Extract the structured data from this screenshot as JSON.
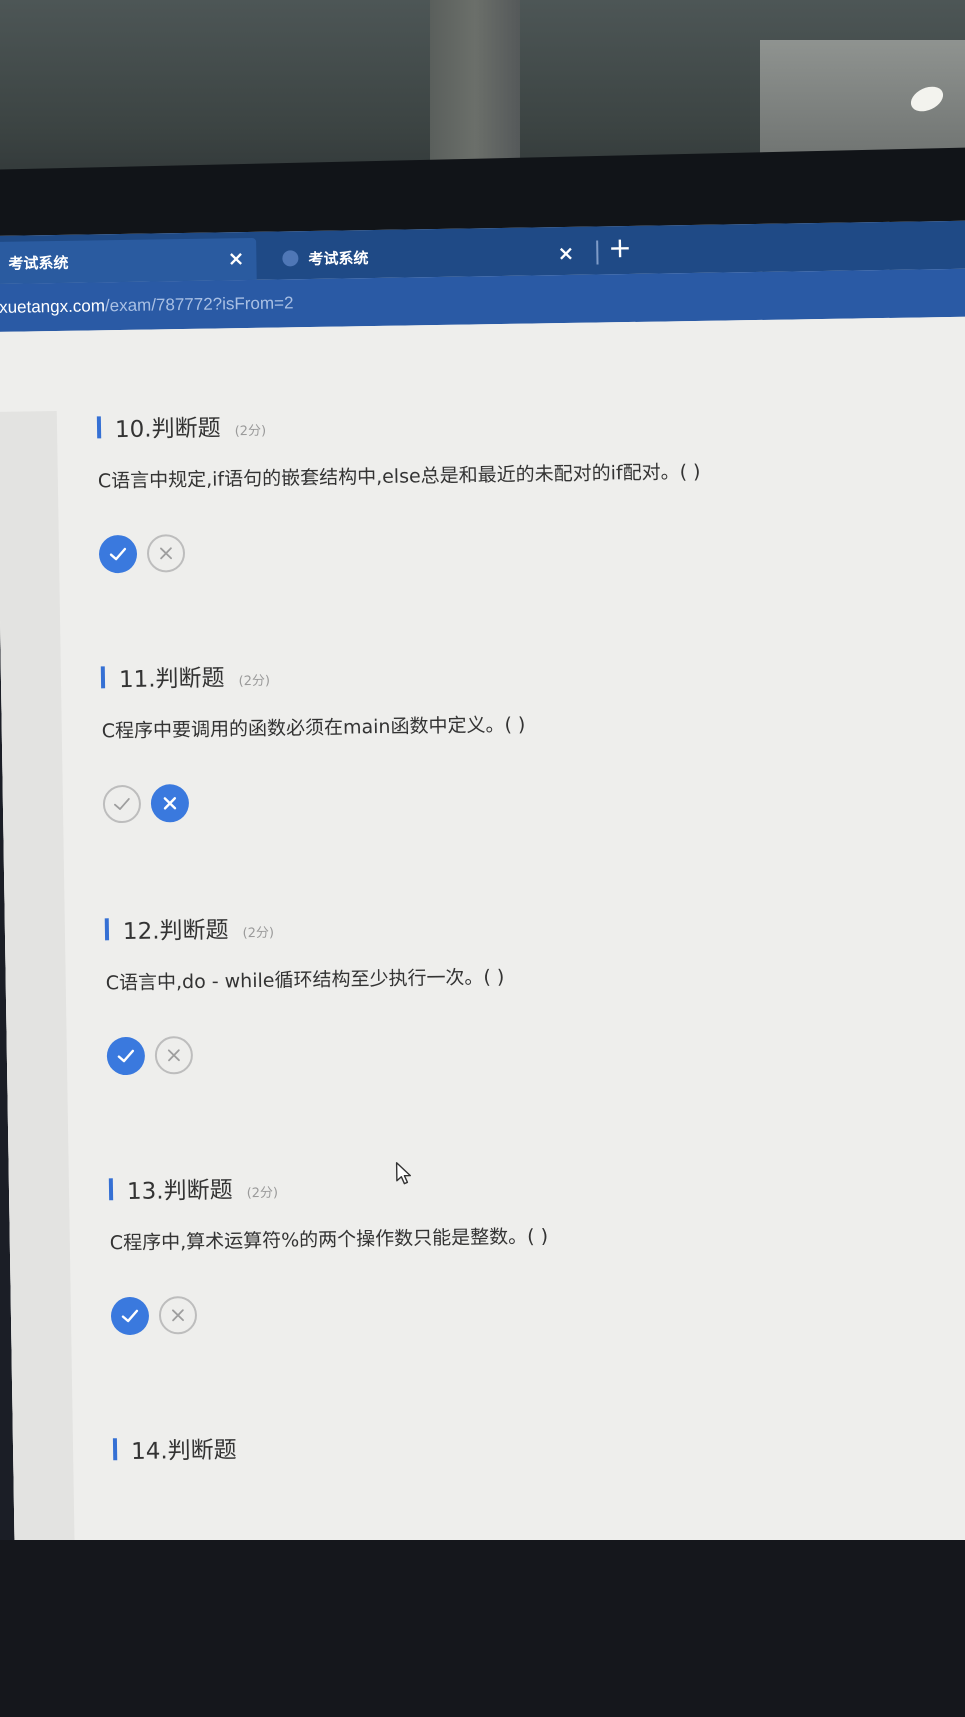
{
  "browser": {
    "tabs": [
      {
        "label": "考试系统",
        "active": true
      },
      {
        "label": "考试系统",
        "active": false
      }
    ],
    "new_tab_symbol": "+",
    "close_symbol": "×",
    "url_domain": "xuetangx.com",
    "url_path": "/exam/787772?isFrom=2"
  },
  "questions": [
    {
      "title": "10.判断题",
      "points": "(2分)",
      "text": "C语言中规定,if语句的嵌套结构中,else总是和最近的未配对的if配对。( )",
      "selected": "true"
    },
    {
      "title": "11.判断题",
      "points": "(2分)",
      "text": "C程序中要调用的函数必须在main函数中定义。( )",
      "selected": "false"
    },
    {
      "title": "12.判断题",
      "points": "(2分)",
      "text": "C语言中,do - while循环结构至少执行一次。( )",
      "selected": "true"
    },
    {
      "title": "13.判断题",
      "points": "(2分)",
      "text": "C程序中,算术运算符%的两个操作数只能是整数。( )",
      "selected": "true"
    },
    {
      "title": "14.判断题",
      "points": "",
      "text": "",
      "selected": ""
    }
  ],
  "colors": {
    "accent": "#3a79de",
    "tabbar": "#1f4a86",
    "addressbar": "#2a5aa5"
  },
  "icons": {
    "true_option": "check-icon",
    "false_option": "cross-icon",
    "tab": "favicon-icon",
    "pointer": "mouse-cursor-icon"
  }
}
